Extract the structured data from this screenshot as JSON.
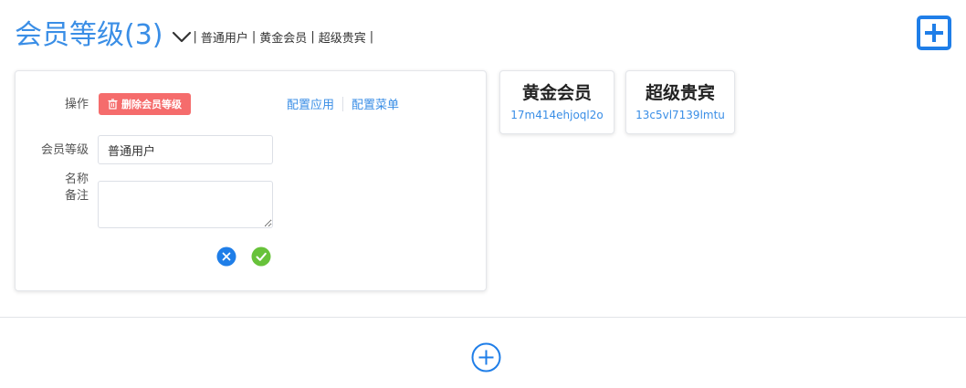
{
  "header": {
    "title": "会员等级(3)",
    "levels": [
      "普通用户",
      "黄金会员",
      "超级贵宾"
    ],
    "separator": "|"
  },
  "edit_form": {
    "operation_label": "操作",
    "delete_button_label": "删除会员等级",
    "configure_app_link": "配置应用",
    "configure_menu_link": "配置菜单",
    "level_name_label_line1": "会员等级",
    "level_name_label_line2": "名称",
    "level_name_value": "普通用户",
    "remark_label": "备注",
    "remark_value": ""
  },
  "level_cards": [
    {
      "name": "黄金会员",
      "code": "17m414ehjoql2o"
    },
    {
      "name": "超级贵宾",
      "code": "13c5vl7139lmtu"
    }
  ],
  "colors": {
    "accent": "#3a8ee6",
    "danger": "#f56c6c",
    "success": "#67c23a",
    "cancel": "#1f7ee8"
  },
  "icons": {
    "title_caret": "chevron-down-icon",
    "top_add": "plus-square-icon",
    "delete": "trash-icon",
    "cancel": "close-circle-icon",
    "confirm": "check-circle-icon",
    "bottom_add": "plus-circle-icon"
  }
}
